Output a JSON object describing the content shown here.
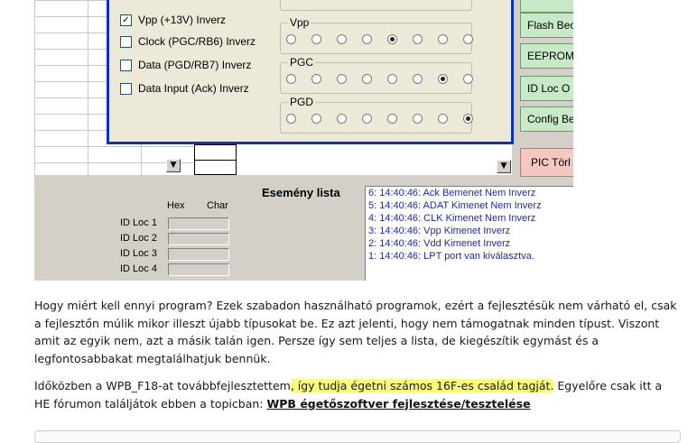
{
  "app": {
    "checkboxes": [
      {
        "label": "Vpp (+13V) Inverz",
        "checked": true
      },
      {
        "label": "Clock (PGC/RB6) Inverz",
        "checked": false
      },
      {
        "label": "Data (PGD/RB7) Inverz",
        "checked": false
      },
      {
        "label": "Data Input (Ack) Inverz",
        "checked": false
      }
    ],
    "radio_groups": [
      {
        "label": "Vpp",
        "selected_index": 4,
        "count": 8
      },
      {
        "label": "PGC",
        "selected_index": 6,
        "count": 8
      },
      {
        "label": "PGD",
        "selected_index": 7,
        "count": 8
      }
    ],
    "side_buttons": [
      "Flash Beo",
      "EEPROM",
      "ID Loc O",
      "Config Beo",
      "PIC Törl"
    ],
    "event_list_title": "Esemény lista",
    "events": [
      "6:  14:40:46:  Ack Bemenet Nem Inverz",
      "5:  14:40:46:  ADAT Kimenet Nem Inverz",
      "4:  14:40:46:  CLK Kimenet Nem Inverz",
      "3:  14:40:46:  Vpp Kimenet Inverz",
      "2:  14:40:46:  Vdd Kimenet Inverz",
      "1:  14:40:46:  LPT port van kiválasztva."
    ],
    "id_headers": {
      "hex": "Hex",
      "char": "Char"
    },
    "id_locs": [
      "ID Loc 1",
      "ID Loc 2",
      "ID Loc 3",
      "ID Loc 4"
    ],
    "scroll_down_glyph": "▼"
  },
  "post": {
    "paragraph1": " Hogy miért kell ennyi program? Ezek szabadon használható programok, ezért a fejlesztésük nem várható el, csak a fejlesztőn múlik mikor illeszt újabb típusokat be. Ez azt jelenti, hogy nem támogatnak minden típust. Viszont amit az egyik nem, azt a másik talán igen. Persze így sem teljes a lista, de kiegészítik egymást és a legfontosabbakat megtalálhatjuk bennük.",
    "p2_before": "Időközben a WPB_F18-at továbbfejlesztettem",
    "p2_highlight": ", így tudja égetni számos 16F-es család tagját.",
    "p2_after": " Egyelőre csak itt a HE fórumon találjátok ebben a topicban: ",
    "p2_link": "WPB égetőszoftver fejlesztése/tesztelése"
  }
}
